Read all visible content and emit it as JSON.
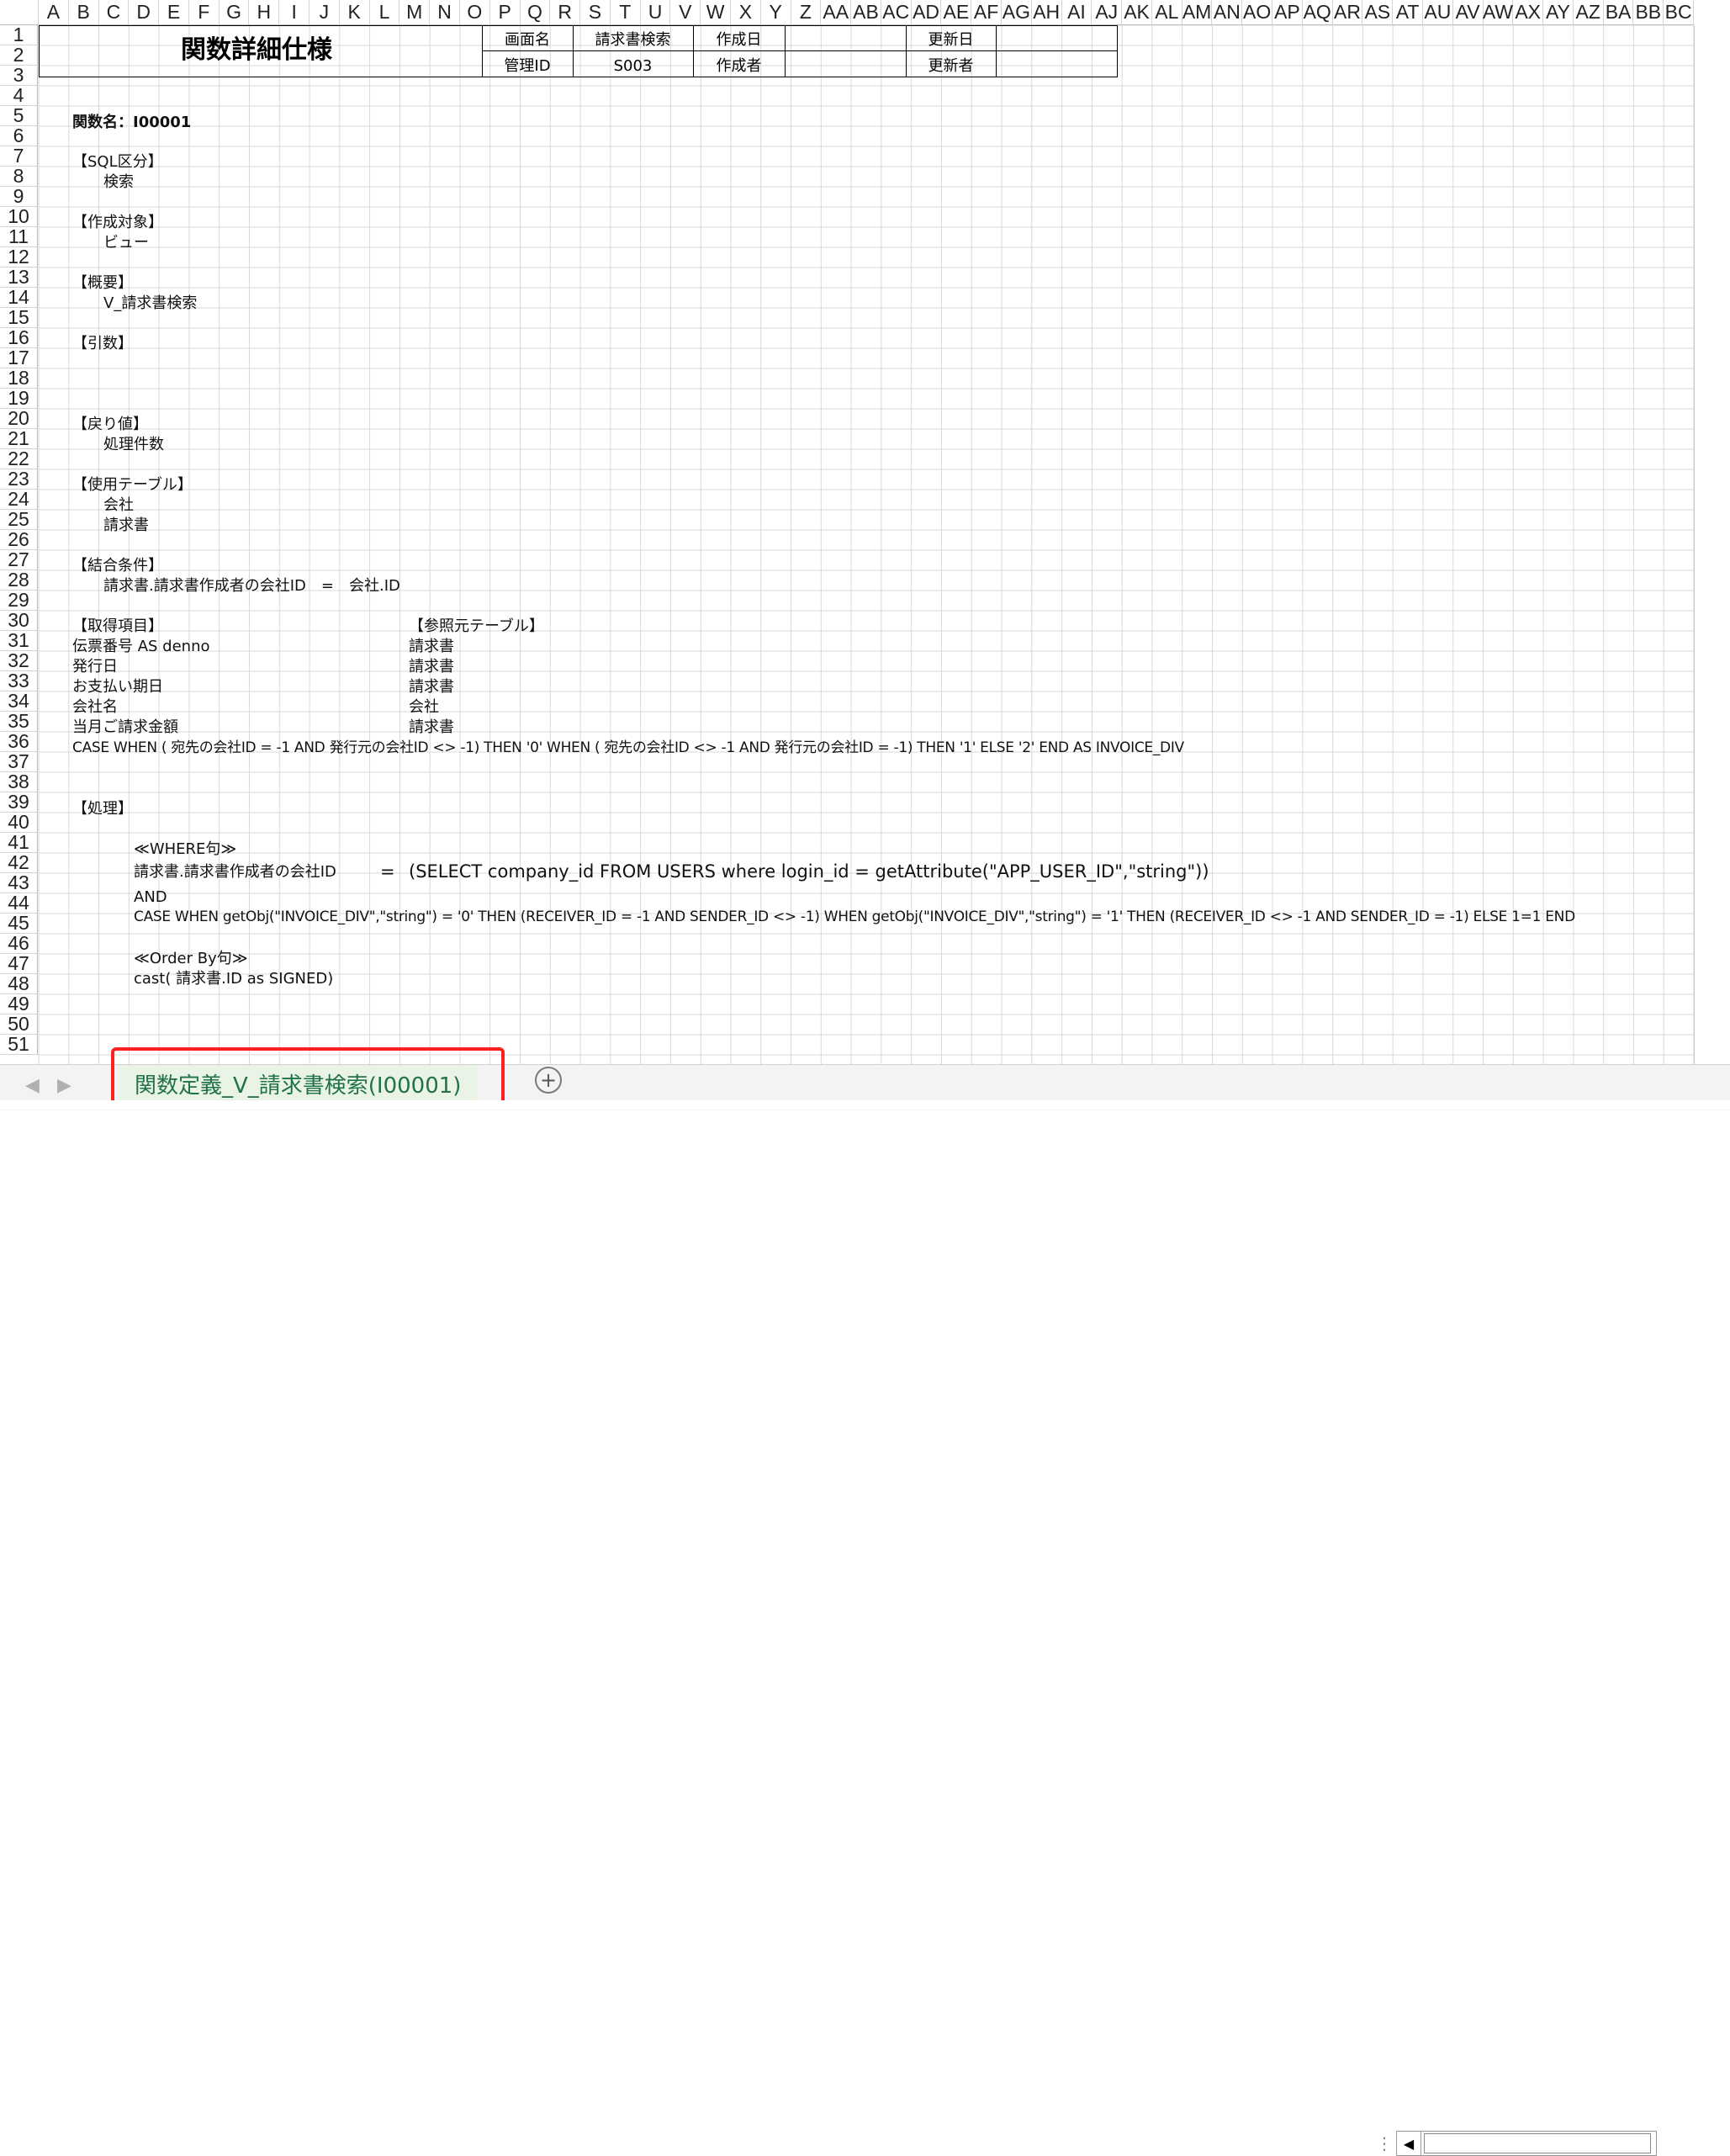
{
  "columns": [
    "A",
    "B",
    "C",
    "D",
    "E",
    "F",
    "G",
    "H",
    "I",
    "J",
    "K",
    "L",
    "M",
    "N",
    "O",
    "P",
    "Q",
    "R",
    "S",
    "T",
    "U",
    "V",
    "W",
    "X",
    "Y",
    "Z",
    "AA",
    "AB",
    "AC",
    "AD",
    "AE",
    "AF",
    "AG",
    "AH",
    "AI",
    "AJ",
    "AK",
    "AL",
    "AM",
    "AN",
    "AO",
    "AP",
    "AQ",
    "AR",
    "AS",
    "AT",
    "AU",
    "AV",
    "AW",
    "AX",
    "AY",
    "AZ",
    "BA",
    "BB",
    "BC"
  ],
  "rows": [
    "1",
    "2",
    "3",
    "4",
    "5",
    "6",
    "7",
    "8",
    "9",
    "10",
    "11",
    "12",
    "13",
    "14",
    "15",
    "16",
    "17",
    "18",
    "19",
    "20",
    "21",
    "22",
    "23",
    "24",
    "25",
    "26",
    "27",
    "28",
    "29",
    "30",
    "31",
    "32",
    "33",
    "34",
    "35",
    "36",
    "37",
    "38",
    "39",
    "40",
    "41",
    "42",
    "43",
    "44",
    "45",
    "46",
    "47",
    "48",
    "49",
    "50",
    "51"
  ],
  "header": {
    "title": "関数詳細仕様",
    "screen_name_label": "画面名",
    "screen_name_value": "請求書検索",
    "created_date_label": "作成日",
    "created_date_value": "",
    "updated_date_label": "更新日",
    "updated_date_value": "",
    "manage_id_label": "管理ID",
    "manage_id_value": "S003",
    "author_label": "作成者",
    "author_value": "",
    "updater_label": "更新者",
    "updater_value": ""
  },
  "content": {
    "function_name": "関数名：I00001",
    "sql_type_label": "【SQL区分】",
    "sql_type_value": "検索",
    "target_label": "【作成対象】",
    "target_value": "ビュー",
    "summary_label": "【概要】",
    "summary_value": "V_請求書検索",
    "args_label": "【引数】",
    "return_label": "【戻り値】",
    "return_value": "処理件数",
    "tables_label": "【使用テーブル】",
    "table_1": "会社",
    "table_2": "請求書",
    "join_label": "【結合条件】",
    "join_value": "請求書.請求書作成者の会社ID　=　会社.ID",
    "items_label": "【取得項目】",
    "ref_label": "【参照元テーブル】",
    "items": [
      {
        "name": "伝票番号 AS denno",
        "ref": "請求書"
      },
      {
        "name": "発行日",
        "ref": "請求書"
      },
      {
        "name": "お支払い期日",
        "ref": "請求書"
      },
      {
        "name": "会社名",
        "ref": "会社"
      },
      {
        "name": "当月ご請求金額",
        "ref": "請求書"
      }
    ],
    "case_line": "CASE WHEN ( 宛先の会社ID = -1 AND 発行元の会社ID <> -1) THEN '0' WHEN ( 宛先の会社ID <> -1 AND 発行元の会社ID = -1)  THEN '1' ELSE '2' END AS INVOICE_DIV",
    "process_label": "【処理】",
    "where_label": "≪WHERE句≫",
    "where_left": "請求書.請求書作成者の会社ID",
    "where_eq": "=",
    "where_right": "(SELECT company_id FROM USERS where login_id = getAttribute(\"APP_USER_ID\",\"string\"))",
    "and_text": "AND",
    "case_where": "CASE WHEN getObj(\"INVOICE_DIV\",\"string\") = '0' THEN (RECEIVER_ID = -1 AND SENDER_ID <> -1) WHEN getObj(\"INVOICE_DIV\",\"string\") = '1' THEN (RECEIVER_ID <> -1 AND SENDER_ID = -1) ELSE 1=1 END",
    "orderby_label": "≪Order By句≫",
    "orderby_value": "cast( 請求書.ID as SIGNED)"
  },
  "tabs": {
    "active": "関数定義_V_請求書検索(I00001)"
  },
  "icons": {
    "add_sheet": "plus-circle-icon",
    "scroll_left": "triangle-left-icon"
  },
  "colors": {
    "grid": "#d4d4d4",
    "tab_green": "#217346",
    "highlight_red": "#ff2020"
  }
}
